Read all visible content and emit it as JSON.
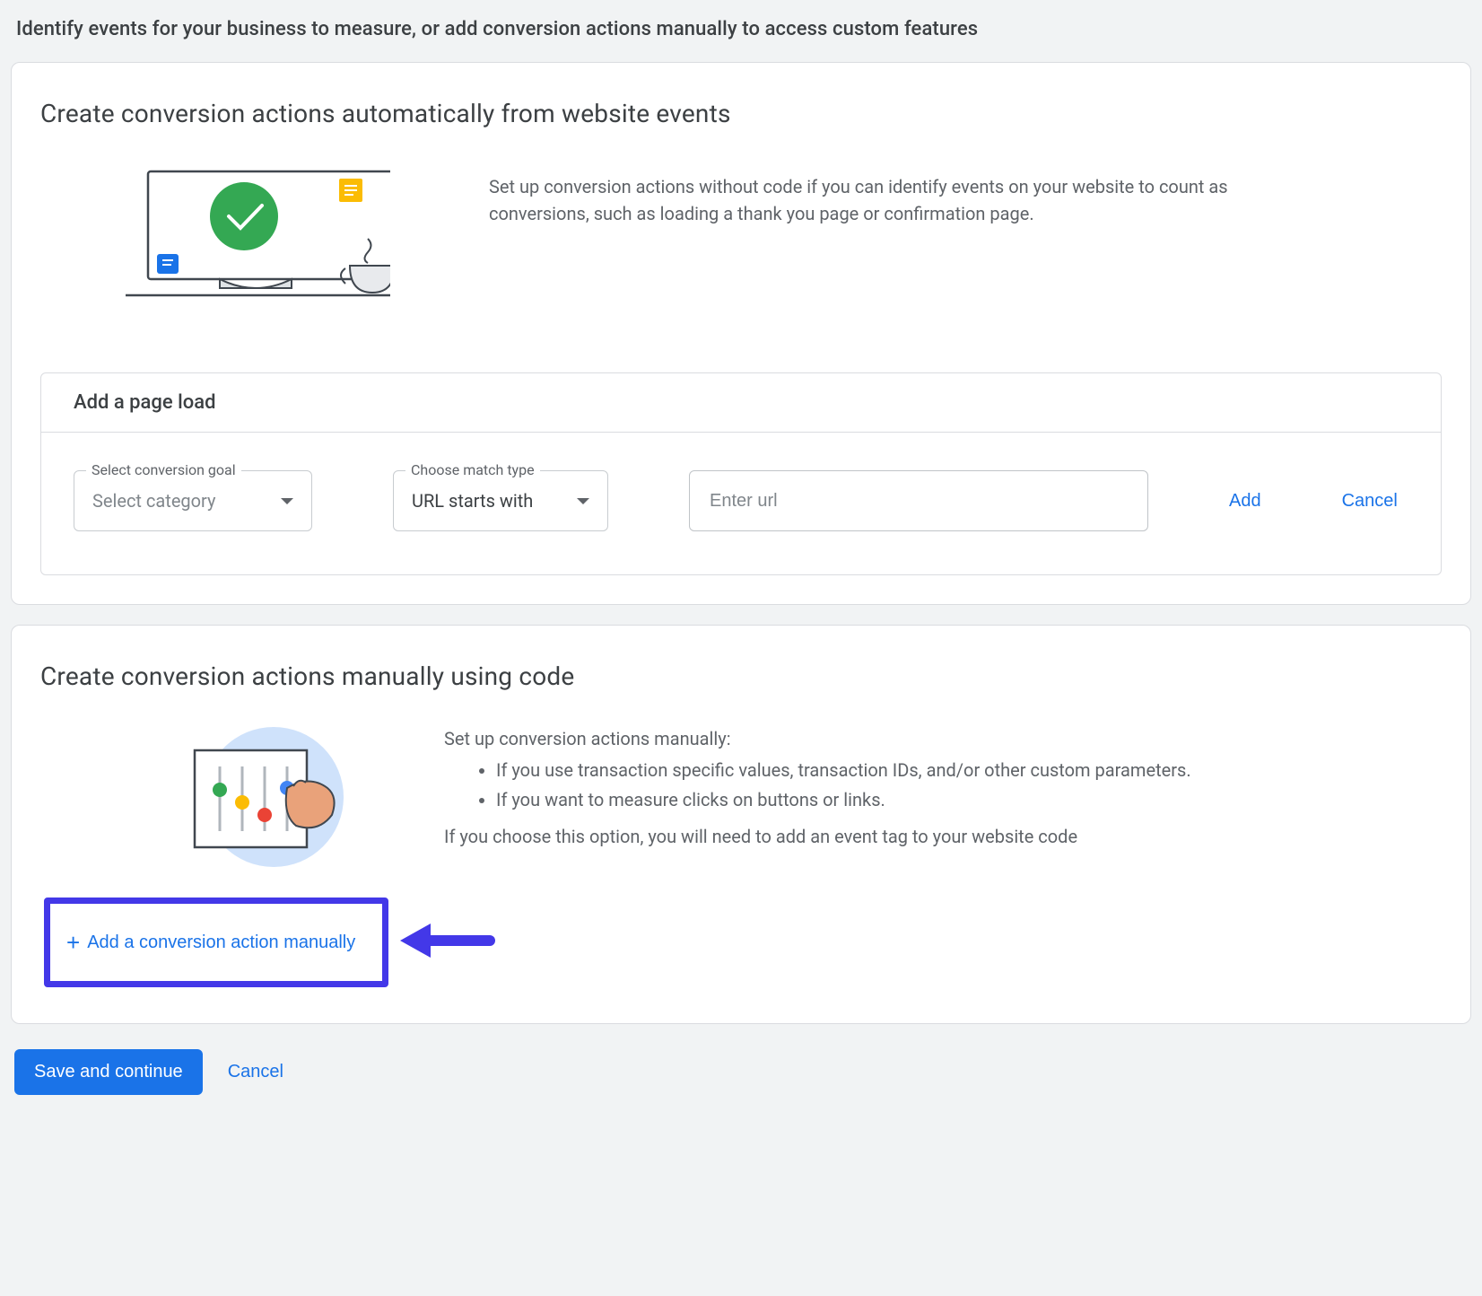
{
  "header": {
    "title": "Identify events for your business to measure, or add conversion actions manually to access custom features"
  },
  "card1": {
    "title": "Create conversion actions automatically from website events",
    "description": "Set up conversion actions without code if you can identify events on your website to count as conversions, such as loading a thank you page or confirmation page.",
    "panel_title": "Add a page load",
    "goal_label": "Select conversion goal",
    "goal_placeholder": "Select category",
    "match_label": "Choose match type",
    "match_value": "URL starts with",
    "url_placeholder": "Enter url",
    "add_label": "Add",
    "cancel_label": "Cancel"
  },
  "card2": {
    "title": "Create conversion actions manually using code",
    "intro": "Set up conversion actions manually:",
    "bullet1": "If you use transaction specific values, transaction IDs, and/or other custom parameters.",
    "bullet2": "If you want to measure clicks on buttons or links.",
    "outro": "If you choose this option, you will need to add an event tag to your website code",
    "add_manual_label": "Add a conversion action manually"
  },
  "footer": {
    "save_label": "Save and continue",
    "cancel_label": "Cancel"
  },
  "colors": {
    "accent": "#1a73e8",
    "highlight_border": "#4338e8"
  }
}
